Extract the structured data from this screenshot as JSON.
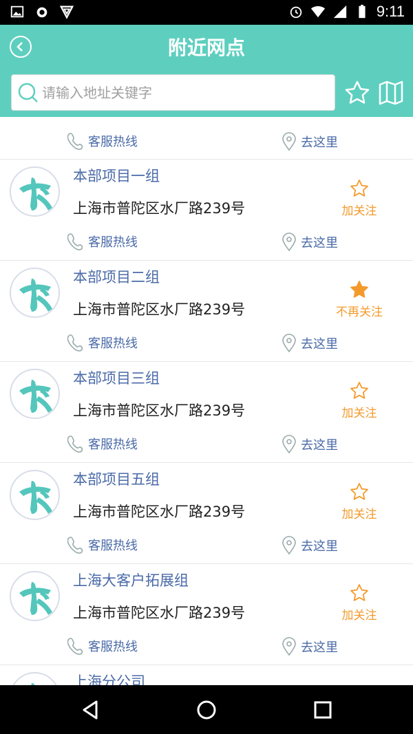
{
  "status_bar": {
    "time": "9:11"
  },
  "header": {
    "title": "附近网点",
    "search_placeholder": "请输入地址关键字"
  },
  "labels": {
    "hotline": "客服热线",
    "go_here": "去这里"
  },
  "items": [
    {
      "name": "本部项目一组",
      "address": "上海市普陀区水厂路239号",
      "follow_label": "加关注",
      "followed": false
    },
    {
      "name": "本部项目二组",
      "address": "上海市普陀区水厂路239号",
      "follow_label": "不再关注",
      "followed": true
    },
    {
      "name": "本部项目三组",
      "address": "上海市普陀区水厂路239号",
      "follow_label": "加关注",
      "followed": false
    },
    {
      "name": "本部项目五组",
      "address": "上海市普陀区水厂路239号",
      "follow_label": "加关注",
      "followed": false
    },
    {
      "name": "上海大客户拓展组",
      "address": "上海市普陀区水厂路239号",
      "follow_label": "加关注",
      "followed": false
    },
    {
      "name": "上海分公司",
      "address": "",
      "follow_label": "",
      "followed": false
    }
  ],
  "colors": {
    "accent": "#5ecfbf",
    "link": "#4a6aa8",
    "follow": "#f39a2b"
  }
}
